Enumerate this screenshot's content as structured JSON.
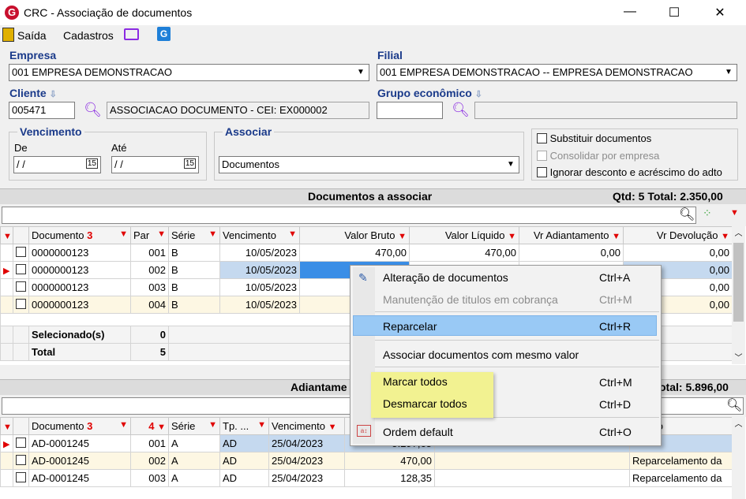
{
  "window": {
    "title": "CRC - Associação de documentos",
    "logo": "G"
  },
  "menu": {
    "exit": "Saída",
    "registers": "Cadastros"
  },
  "form": {
    "company_label": "Empresa",
    "company_value": "001 EMPRESA DEMONSTRACAO",
    "branch_label": "Filial",
    "branch_value": "001 EMPRESA DEMONSTRACAO -- EMPRESA DEMONSTRACAO",
    "client_label": "Cliente",
    "client_code": "005471",
    "client_name": "ASSOCIACAO DOCUMENTO - CEI: EX000002",
    "group_label": "Grupo econômico",
    "due_label": "Vencimento",
    "from_label": "De",
    "to_label": "Até",
    "from_value": "/ /",
    "to_value": "/ /",
    "cal_icon": "15",
    "associate_label": "Associar",
    "associate_value": "Documentos",
    "opt_replace": "Substituir documentos",
    "opt_consolidate": "Consolidar por empresa",
    "opt_ignore": "Ignorar desconto e acréscimo do adto"
  },
  "docs": {
    "title": "Documentos a associar",
    "summary": "Qtd: 5 Total: 2.350,00",
    "headers": {
      "documento": "Documento",
      "sort": "3",
      "par": "Par",
      "serie": "Série",
      "venc": "Vencimento",
      "bruto": "Valor Bruto",
      "liquido": "Valor Líquido",
      "adiant": "Vr Adiantamento",
      "devol": "Vr Devolução"
    },
    "rows": [
      {
        "doc": "0000000123",
        "par": "001",
        "serie": "B",
        "venc": "10/05/2023",
        "bruto": "470,00",
        "liquido": "470,00",
        "adiant": "0,00",
        "devol": "0,00"
      },
      {
        "doc": "0000000123",
        "par": "002",
        "serie": "B",
        "venc": "10/05/2023",
        "devol": "0,00"
      },
      {
        "doc": "0000000123",
        "par": "003",
        "serie": "B",
        "venc": "10/05/2023",
        "devol": "0,00"
      },
      {
        "doc": "0000000123",
        "par": "004",
        "serie": "B",
        "venc": "10/05/2023",
        "devol": "0,00"
      }
    ],
    "selected_label": "Selecionado(s)",
    "selected_value": "0",
    "total_label": "Total",
    "total_value": "5"
  },
  "adv": {
    "title": "Adiantame",
    "summary": "otal: 5.896,00",
    "headers": {
      "documento": "Documento",
      "sort1": "3",
      "sort2": "4",
      "serie": "Série",
      "tp": "Tp. ...",
      "venc": "Vencimento",
      "obs": "rvação"
    },
    "rows": [
      {
        "doc": "AD-0001245",
        "par": "001",
        "serie": "A",
        "tp": "AD",
        "venc": "25/04/2023",
        "valor": "5.297,65",
        "obs": ""
      },
      {
        "doc": "AD-0001245",
        "par": "002",
        "serie": "A",
        "tp": "AD",
        "venc": "25/04/2023",
        "valor": "470,00",
        "obs": "Reparcelamento da"
      },
      {
        "doc": "AD-0001245",
        "par": "003",
        "serie": "A",
        "tp": "AD",
        "venc": "25/04/2023",
        "valor": "128,35",
        "obs": "Reparcelamento da"
      }
    ]
  },
  "context_menu": [
    {
      "label": "Alteração de documentos",
      "shortcut": "Ctrl+A"
    },
    {
      "label": "Manutenção de titulos em cobrança",
      "shortcut": "Ctrl+M"
    },
    {
      "label": "Reparcelar",
      "shortcut": "Ctrl+R"
    },
    {
      "label": "Associar documentos com mesmo valor",
      "shortcut": ""
    },
    {
      "label": "Marcar todos",
      "shortcut": "Ctrl+M"
    },
    {
      "label": "Desmarcar todos",
      "shortcut": "Ctrl+D"
    },
    {
      "label": "Ordem default",
      "shortcut": "Ctrl+O"
    }
  ],
  "colors": {
    "accent": "#1a3a8a",
    "highlight": "#99c9f5",
    "callout": "#f2f291"
  }
}
